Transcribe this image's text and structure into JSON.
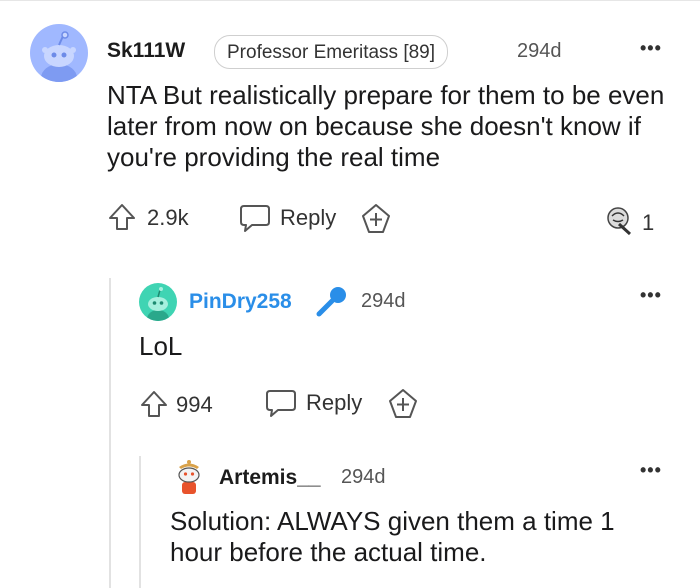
{
  "comment1": {
    "username": "Sk111W",
    "flair": "Professor Emeritass [89]",
    "age": "294d",
    "body": "NTA But realistically prepare for them to be even later from now on because she doesn't know if you're providing the real time",
    "upvotes": "2.9k",
    "reply_label": "Reply",
    "award_count": "1"
  },
  "comment2": {
    "username": "PinDry258",
    "age": "294d",
    "body": "LoL",
    "upvotes": "994",
    "reply_label": "Reply"
  },
  "comment3": {
    "username": "Artemis__",
    "age": "294d",
    "body": "Solution: ALWAYS given them a time 1 hour before the actual time."
  },
  "more_menu": "•••",
  "colors": {
    "avatar1_bg": "#a0b8ff",
    "avatar2_bg": "#3fd4b3",
    "username2": "#2a8ee8",
    "mic": "#2a8ee8"
  }
}
